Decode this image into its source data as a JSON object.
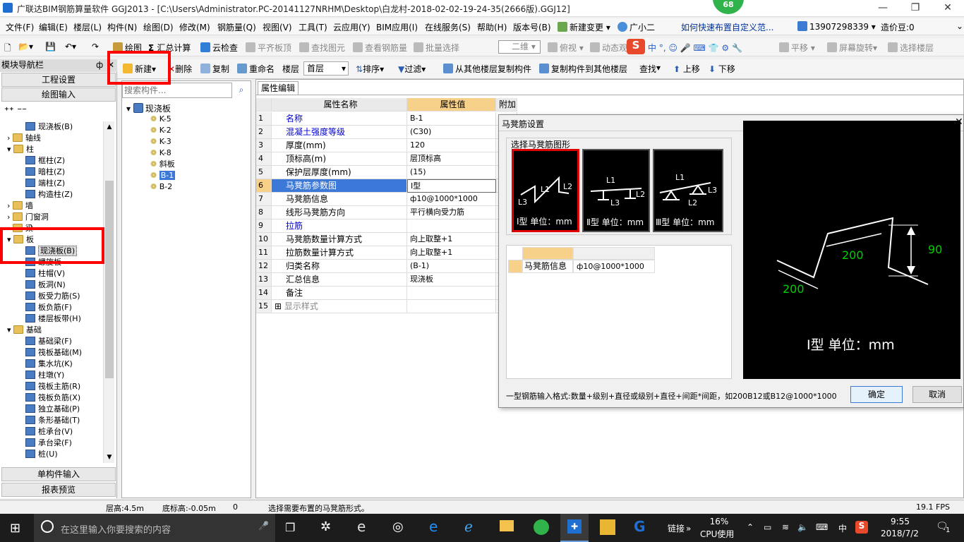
{
  "window": {
    "title": "广联达BIM钢筋算量软件 GGJ2013 - [C:\\Users\\Administrator.PC-20141127NRHM\\Desktop\\白龙村-2018-02-02-19-24-35(2666版).GGJ12]",
    "badge": "68"
  },
  "menubar": {
    "items": [
      "文件(F)",
      "编辑(E)",
      "楼层(L)",
      "构件(N)",
      "绘图(D)",
      "修改(M)",
      "钢筋量(Q)",
      "视图(V)",
      "工具(T)",
      "云应用(Y)",
      "BIM应用(I)",
      "在线服务(S)",
      "帮助(H)",
      "版本号(B)"
    ],
    "new_change": "新建变更",
    "assistant": "广小二",
    "tip": "如何快速布置自定义范...",
    "phone": "13907298339",
    "price": "造价豆:0"
  },
  "toolbar1": {
    "draw": "绘图",
    "sum": "汇总计算",
    "cloud_check": "云检查",
    "flat_top": "平齐板顶",
    "find_elem": "查找图元",
    "view_rebar": "查看钢筋量",
    "batch_select": "批量选择",
    "view_mode": "二维",
    "plan_view": "俯视",
    "dynamic": "动态观",
    "translate": "平移",
    "rotate_screen": "屏幕旋转",
    "select_floor": "选择楼层"
  },
  "toolbar2": {
    "new": "新建",
    "delete": "删除",
    "copy": "复制",
    "rename": "重命名",
    "floor_label": "楼层",
    "floor_value": "首层",
    "sort": "排序",
    "filter": "过滤",
    "copy_from": "从其他楼层复制构件",
    "copy_to": "复制构件到其他楼层",
    "find": "查找",
    "move_up": "上移",
    "move_down": "下移"
  },
  "leftpanel": {
    "title": "模块导航栏",
    "pin": "ф",
    "project_settings": "工程设置",
    "drawing_input": "绘图输入",
    "single_input": "单构件输入",
    "report_preview": "报表预览",
    "tree": [
      {
        "label": "现浇板(B)",
        "type": "comp",
        "indent": 2
      },
      {
        "label": "轴线",
        "type": "folder",
        "indent": 1
      },
      {
        "label": "柱",
        "type": "folder",
        "indent": 1
      },
      {
        "label": "框柱(Z)",
        "type": "comp",
        "indent": 2
      },
      {
        "label": "暗柱(Z)",
        "type": "comp",
        "indent": 2
      },
      {
        "label": "端柱(Z)",
        "type": "comp",
        "indent": 2
      },
      {
        "label": "构造柱(Z)",
        "type": "comp",
        "indent": 2
      },
      {
        "label": "墙",
        "type": "folder",
        "indent": 1
      },
      {
        "label": "门窗洞",
        "type": "folder",
        "indent": 1
      },
      {
        "label": "梁",
        "type": "folder",
        "indent": 1
      },
      {
        "label": "板",
        "type": "folder",
        "indent": 1
      },
      {
        "label": "现浇板(B)",
        "type": "comp",
        "indent": 2,
        "selected": true
      },
      {
        "label": "螺旋板",
        "type": "comp",
        "indent": 2
      },
      {
        "label": "柱帽(V)",
        "type": "comp",
        "indent": 2
      },
      {
        "label": "板洞(N)",
        "type": "comp",
        "indent": 2
      },
      {
        "label": "板受力筋(S)",
        "type": "comp",
        "indent": 2
      },
      {
        "label": "板负筋(F)",
        "type": "comp",
        "indent": 2
      },
      {
        "label": "楼层板带(H)",
        "type": "comp",
        "indent": 2
      },
      {
        "label": "基础",
        "type": "folder",
        "indent": 1
      },
      {
        "label": "基础梁(F)",
        "type": "comp",
        "indent": 2
      },
      {
        "label": "筏板基础(M)",
        "type": "comp",
        "indent": 2
      },
      {
        "label": "集水坑(K)",
        "type": "comp",
        "indent": 2
      },
      {
        "label": "柱墩(Y)",
        "type": "comp",
        "indent": 2
      },
      {
        "label": "筏板主筋(R)",
        "type": "comp",
        "indent": 2
      },
      {
        "label": "筏板负筋(X)",
        "type": "comp",
        "indent": 2
      },
      {
        "label": "独立基础(P)",
        "type": "comp",
        "indent": 2
      },
      {
        "label": "条形基础(T)",
        "type": "comp",
        "indent": 2
      },
      {
        "label": "桩承台(V)",
        "type": "comp",
        "indent": 2
      },
      {
        "label": "承台梁(F)",
        "type": "comp",
        "indent": 2
      },
      {
        "label": "桩(U)",
        "type": "comp",
        "indent": 2
      }
    ]
  },
  "complist": {
    "search_placeholder": "搜索构件...",
    "root": "现浇板",
    "items": [
      "K-5",
      "K-2",
      "K-3",
      "K-8",
      "斜板",
      "B-1",
      "B-2"
    ],
    "selected": "B-1"
  },
  "propgrid": {
    "tab": "属性编辑",
    "col_name": "属性名称",
    "col_value": "属性值",
    "col_extra": "附加",
    "rows": [
      {
        "no": "1",
        "name": "名称",
        "value": "B-1",
        "blue": true
      },
      {
        "no": "2",
        "name": "混凝土强度等级",
        "value": "(C30)",
        "blue": true
      },
      {
        "no": "3",
        "name": "厚度(mm)",
        "value": "120"
      },
      {
        "no": "4",
        "name": "顶标高(m)",
        "value": "层顶标高"
      },
      {
        "no": "5",
        "name": "保护层厚度(mm)",
        "value": "(15)"
      },
      {
        "no": "6",
        "name": "马凳筋参数图",
        "value": "Ⅰ型",
        "selected": true
      },
      {
        "no": "7",
        "name": "马凳筋信息",
        "value": "ф10@1000*1000"
      },
      {
        "no": "8",
        "name": "线形马凳筋方向",
        "value": "平行横向受力筋"
      },
      {
        "no": "9",
        "name": "拉筋",
        "value": "",
        "blue": true
      },
      {
        "no": "10",
        "name": "马凳筋数量计算方式",
        "value": "向上取整+1"
      },
      {
        "no": "11",
        "name": "拉筋数量计算方式",
        "value": "向上取整+1"
      },
      {
        "no": "12",
        "name": "归类名称",
        "value": "(B-1)"
      },
      {
        "no": "13",
        "name": "汇总信息",
        "value": "现浇板"
      },
      {
        "no": "14",
        "name": "备注",
        "value": ""
      },
      {
        "no": "15",
        "name": "显示样式",
        "value": "",
        "expand": true
      }
    ]
  },
  "dialog": {
    "title": "马凳筋设置",
    "close": "✕",
    "choose_shape": "选择马凳筋图形",
    "shapes": [
      {
        "label": "Ⅰ型 单位：mm",
        "selected": true
      },
      {
        "label": "Ⅱ型 单位：mm"
      },
      {
        "label": "Ⅲ型 单位：mm"
      }
    ],
    "shape_tags": {
      "l1": "L1",
      "l2": "L2",
      "l3": "L3"
    },
    "table_row_label": "马凳筋信息",
    "table_row_value": "ф10@1000*1000",
    "preview_dim_a": "200",
    "preview_dim_b": "200",
    "preview_dim_h": "90",
    "preview_caption": "Ⅰ型 单位：mm",
    "hint": "一型钢筋输入格式:数量+级别+直径或级别+直径+间距*间距，如200B12或B12@1000*1000",
    "ok": "确定",
    "cancel": "取消"
  },
  "statusbar": {
    "floor_height": "层高:4.5m",
    "base_elev": "底标高:-0.05m",
    "zero": "0",
    "message": "选择需要布置的马凳筋形式。",
    "fps": "19.1 FPS"
  },
  "taskbar": {
    "search_placeholder": "在这里输入你要搜索的内容",
    "links": "链接",
    "cpu_pct": "16%",
    "cpu_label": "CPU使用",
    "ime": "中",
    "time": "9:55",
    "date": "2018/7/2",
    "notif": "1"
  },
  "colors": {
    "highlight": "#ff0000",
    "selected_row": "#3c78d8",
    "header_orange": "#f7d08a",
    "blue_text": "#0000cc",
    "preview_green": "#00d000"
  }
}
